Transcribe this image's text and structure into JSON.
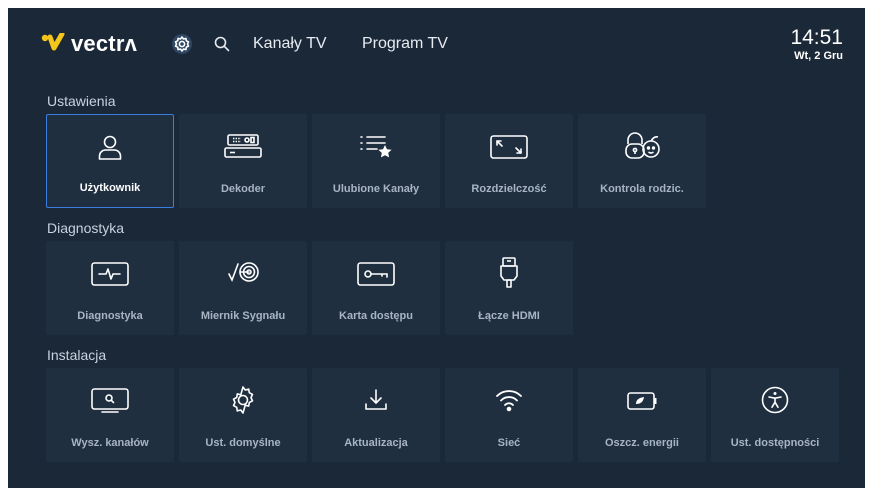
{
  "header": {
    "logo_text": "vectrʌ",
    "nav": {
      "channels": "Kanały TV",
      "program": "Program TV"
    },
    "clock": {
      "time": "14:51",
      "date": "Wt, 2 Gru"
    },
    "brand_colors": {
      "yellow": "#f5c518",
      "focus": "#3b7ee0",
      "background": "#1b2838",
      "tile": "#202f40"
    }
  },
  "sections": {
    "settings": {
      "title": "Ustawienia",
      "tiles": [
        {
          "label": "Użytkownik",
          "icon": "user-icon",
          "focused": true
        },
        {
          "label": "Dekoder",
          "icon": "decoder-icon"
        },
        {
          "label": "Ulubione Kanały",
          "icon": "favorite-list-icon"
        },
        {
          "label": "Rozdzielczość",
          "icon": "resolution-icon"
        },
        {
          "label": "Kontrola rodzic.",
          "icon": "parental-control-icon"
        }
      ]
    },
    "diagnostics": {
      "title": "Diagnostyka",
      "tiles": [
        {
          "label": "Diagnostyka",
          "icon": "pulse-icon"
        },
        {
          "label": "Miernik Sygnału",
          "icon": "signal-meter-icon"
        },
        {
          "label": "Karta dostępu",
          "icon": "access-card-icon"
        },
        {
          "label": "Łącze HDMI",
          "icon": "hdmi-icon"
        }
      ]
    },
    "installation": {
      "title": "Instalacja",
      "tiles": [
        {
          "label": "Wysz. kanałów",
          "icon": "channel-search-icon"
        },
        {
          "label": "Ust. domyślne",
          "icon": "gear-icon"
        },
        {
          "label": "Aktualizacja",
          "icon": "download-icon"
        },
        {
          "label": "Sieć",
          "icon": "wifi-icon"
        },
        {
          "label": "Oszcz. energii",
          "icon": "battery-icon"
        },
        {
          "label": "Ust. dostępności",
          "icon": "accessibility-icon"
        }
      ]
    }
  }
}
